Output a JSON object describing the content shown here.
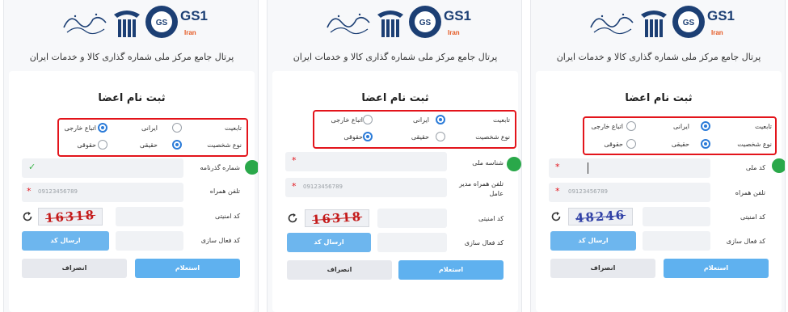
{
  "header": {
    "portal_title": "پرتال جامع مرکز ملی شماره گذاری کالا و خدمات ایران",
    "gs1_text": "GS1",
    "iran_text": "Iran"
  },
  "panels": [
    {
      "form_title": "ثبت نام اعضا",
      "nationality_label": "تابعیت",
      "person_type_label": "نوع شخصیت",
      "option_iranian": "ایرانی",
      "option_foreign": "اتباع خارجی",
      "option_real": "حقیقی",
      "option_legal": "حقوقی",
      "field1_label": "شماره گذرنامه",
      "field1_star": "",
      "field1_placeholder": "",
      "field1_status": "✓",
      "field2_label": "تلفن همراه",
      "field2_star": "*",
      "field2_placeholder": "09123456789",
      "captcha_label": "کد امنیتی",
      "captcha_text": "16318",
      "activation_label": "کد فعال سازی",
      "send_code_button": "ارسال کد",
      "inquiry_button": "استعلام",
      "cancel_button": "انصراف",
      "selected_nationality": "foreign",
      "selected_person_type": "real"
    },
    {
      "form_title": "ثبت نام اعضا",
      "nationality_label": "تابعیت",
      "person_type_label": "نوع شخصیت",
      "option_iranian": "ایرانی",
      "option_foreign": "اتباع خارجی",
      "option_real": "حقیقی",
      "option_legal": "حقوقی",
      "field1_label": "شناسه ملی",
      "field1_star": "*",
      "field1_placeholder": "",
      "field2_label_line1": "تلفن همراه مدیر",
      "field2_label_line2": "عامل",
      "field2_star": "*",
      "field2_placeholder": "09123456789",
      "captcha_label": "کد امنیتی",
      "captcha_text": "16318",
      "activation_label": "کد فعال سازی",
      "send_code_button": "ارسال کد",
      "inquiry_button": "استعلام",
      "cancel_button": "انصراف",
      "selected_nationality": "iranian",
      "selected_person_type": "legal"
    },
    {
      "form_title": "ثبت نام اعضا",
      "nationality_label": "تابعیت",
      "person_type_label": "نوع شخصیت",
      "option_iranian": "ایرانی",
      "option_foreign": "اتباع خارجی",
      "option_real": "حقیقی",
      "option_legal": "حقوقی",
      "field1_label": "کد ملی",
      "field1_star": "*",
      "field2_label": "تلفن همراه",
      "field2_star": "*",
      "field2_placeholder": "09123456789",
      "captcha_label": "کد امنیتی",
      "captcha_text": "48246",
      "activation_label": "کد فعال سازی",
      "send_code_button": "ارسال کد",
      "inquiry_button": "استعلام",
      "cancel_button": "انصراف",
      "selected_nationality": "iranian",
      "selected_person_type": "real"
    }
  ],
  "colors": {
    "highlight_box": "#e3141b",
    "step_marker": "#2aa84a",
    "primary_button": "#5fb1ef",
    "radio_selected": "#2b7bd8"
  }
}
